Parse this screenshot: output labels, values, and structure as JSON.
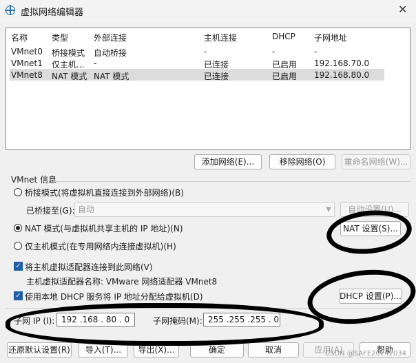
{
  "window": {
    "title": "虚拟网络编辑器",
    "close": "✕"
  },
  "table": {
    "headers": [
      "名称",
      "类型",
      "外部连接",
      "主机连接",
      "DHCP",
      "子网地址"
    ],
    "rows": [
      [
        "VMnet0",
        "桥接模式",
        "自动桥接",
        "-",
        "-",
        "-"
      ],
      [
        "VMnet1",
        "仅主机...",
        "-",
        "已连接",
        "已启用",
        "192.168.70.0"
      ],
      [
        "VMnet8",
        "NAT 模式",
        "NAT 模式",
        "已连接",
        "已启用",
        "192.168.80.0"
      ]
    ],
    "selected_row": 2
  },
  "buttons": {
    "add": "添加网络(E)...",
    "remove": "移除网络(O)",
    "rename": "重命名网络(W)..."
  },
  "vmnet_info": {
    "label": "VMnet 信息",
    "bridge_radio": "桥接模式(将虚拟机直接连接到外部网络)(B)",
    "bridged_to_label": "已桥接至(G):",
    "bridged_to_value": "自动",
    "auto_settings": "自动设置(U)...",
    "nat_radio": "NAT 模式(与虚拟机共享主机的 IP 地址)(N)",
    "nat_settings": "NAT 设置(S)...",
    "hostonly_radio": "仅主机模式(在专用网络内连接虚拟机)(H)",
    "connect_adapter_chk": "将主机虚拟适配器连接到此网络(V)",
    "adapter_name": "主机虚拟适配器名称: VMware 网络适配器 VMnet8",
    "dhcp_chk": "使用本地 DHCP 服务将 IP 地址分配给虚拟机(D)",
    "dhcp_settings": "DHCP 设置(P)...",
    "subnet_ip_label": "子网 IP (I):",
    "subnet_ip": "192 .168 . 80  .  0",
    "subnet_mask_label": "子网掩码(M):",
    "subnet_mask": "255 .255 .255 .  0"
  },
  "footer": {
    "restore": "还原默认设置(R)",
    "import": "导入(T)...",
    "export": "导出(X)...",
    "ok": "确定",
    "cancel": "取消",
    "apply": "应用(A)",
    "help": "帮助"
  },
  "watermark": "CSDN @SAFE20242034",
  "colors": {
    "selection": "#dcdcdc",
    "checkbox": "#1f5fa8",
    "annotation_ink": "#000000"
  }
}
